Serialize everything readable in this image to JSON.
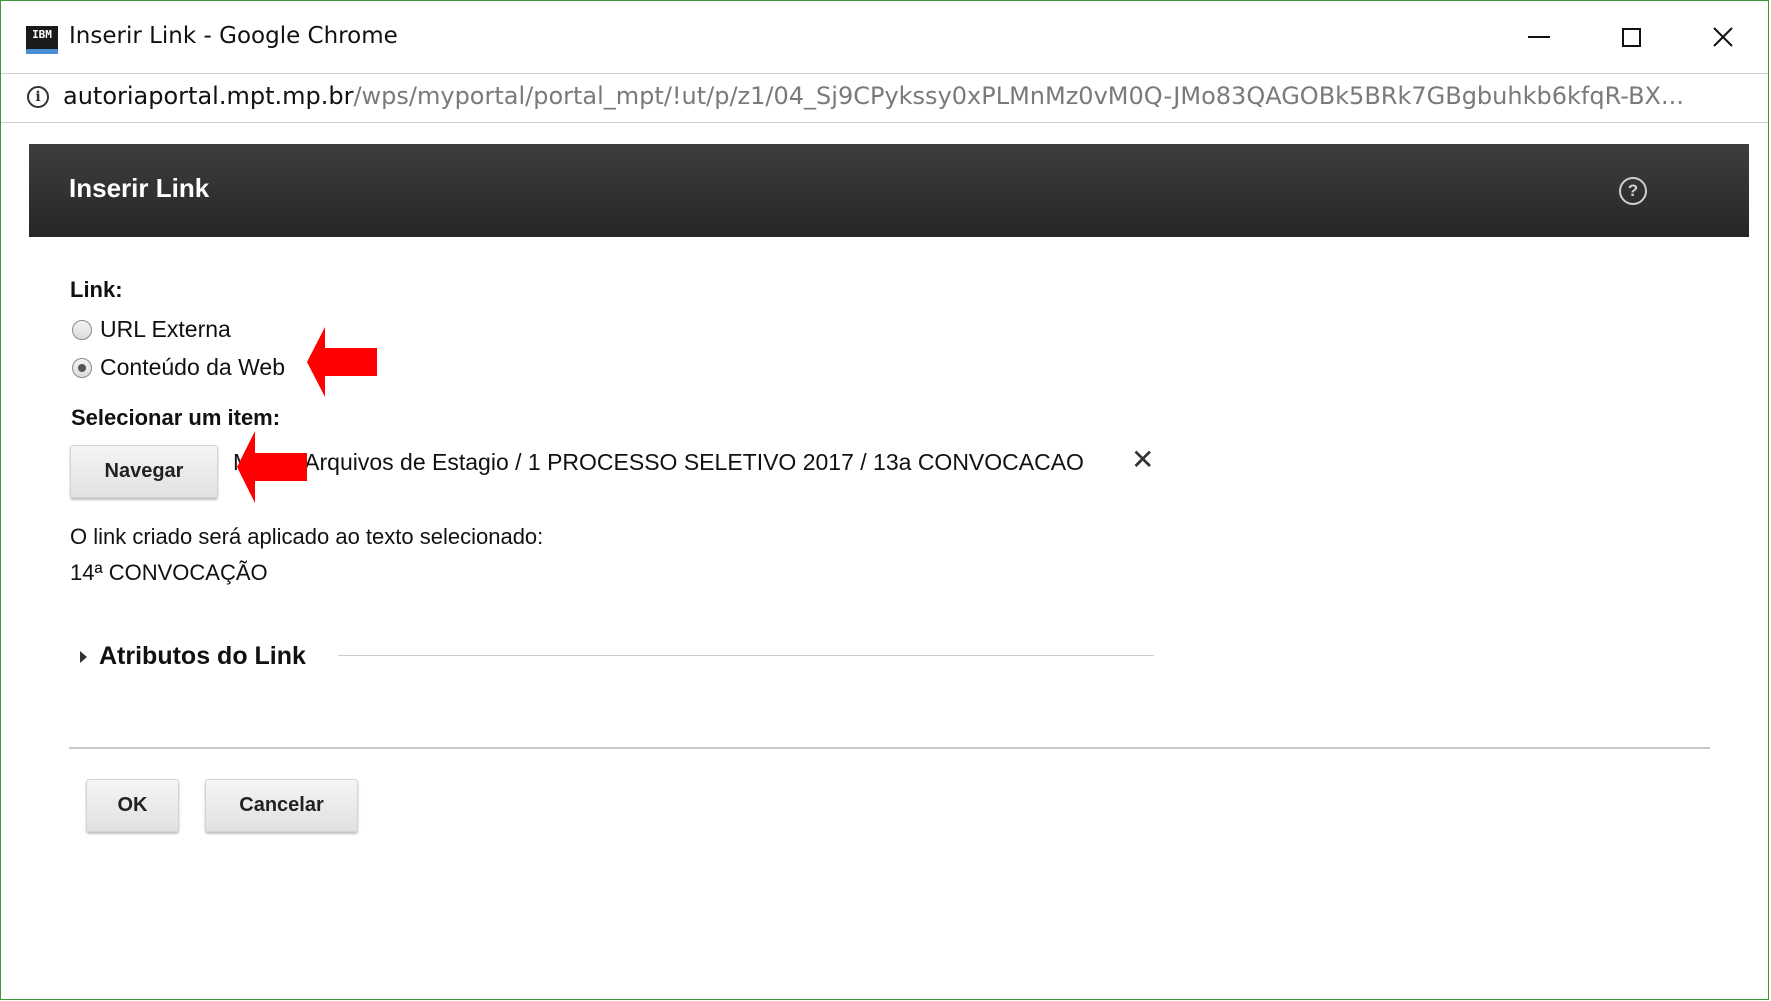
{
  "window": {
    "app_icon_text": "IBM",
    "title": "Inserir Link - Google Chrome"
  },
  "address_bar": {
    "domain": "autoriaportal.mpt.mp.br",
    "path": "/wps/myportal/portal_mpt/!ut/p/z1/04_Sj9CPykssy0xPLMnMz0vM0Q-JMo83QAGOBk5BRk7GBgbuhkb6kfqR-BX..."
  },
  "dialog": {
    "title": "Inserir Link",
    "link_label": "Link:",
    "radio_options": [
      {
        "label": "URL Externa",
        "checked": false
      },
      {
        "label": "Conteúdo da Web",
        "checked": true
      }
    ],
    "select_item_label": "Selecionar um item:",
    "browse_button": "Navegar",
    "selected_item_prefix": "M",
    "selected_item_path": "Arquivos de Estagio / 1 PROCESSO SELETIVO 2017 / 13a CONVOCACAO",
    "applied_text_label": "O link criado será aplicado ao texto selecionado:",
    "applied_text_value": "14ª CONVOCAÇÃO",
    "link_attributes_section": "Atributos do Link",
    "ok_button": "OK",
    "cancel_button": "Cancelar"
  },
  "colors": {
    "window_border": "#3a9a3a",
    "header_background": "#2e2e2e",
    "annotation_arrow": "#ff0000"
  },
  "icons": {
    "info": "info-circle-icon",
    "help": "help-circle-icon",
    "remove": "close-x-icon",
    "expand": "caret-right-icon",
    "annotation": "red-arrow-left-icon"
  }
}
